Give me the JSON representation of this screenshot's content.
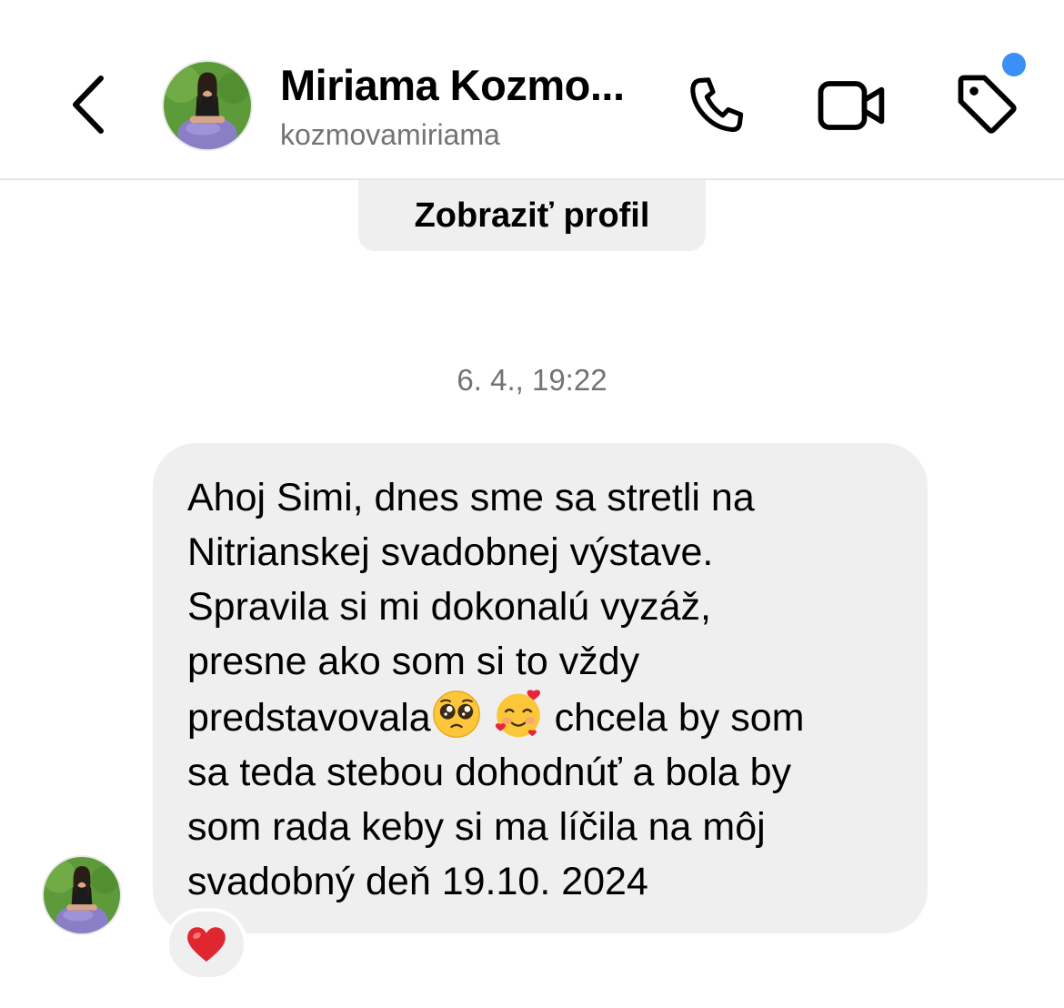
{
  "header": {
    "contact_name": "Miriama Kozmo...",
    "username": "kozmovamiriama",
    "icons": {
      "back": "chevron-left-icon",
      "call": "phone-icon",
      "video": "video-camera-icon",
      "tag": "tag-icon"
    },
    "notification_dot_color": "#3b8ff5"
  },
  "profile_button": {
    "label": "Zobraziť profil"
  },
  "conversation": {
    "timestamp": "6. 4., 19:22",
    "message": {
      "text_part1": "Ahoj Simi, dnes sme sa stretli na\nNitrianskej svadobnej výstave.\nSpravila si mi dokonalú vyzáž,\npresne ako som si to vždy\npredstavovala",
      "emoji1": "pleading-face-emoji",
      "emoji2": "smiling-face-with-hearts-emoji",
      "text_part2": " chcela by som\nsa teda stebou dohodnúť a bola by\nsom rada keby si ma líčila na môj\nsvadobný deň 19.10. 2024",
      "reaction": "red-heart-emoji"
    }
  },
  "colors": {
    "bubble_bg": "#efefef",
    "secondary_text": "#737373",
    "reaction_heart": "#e0262f"
  }
}
